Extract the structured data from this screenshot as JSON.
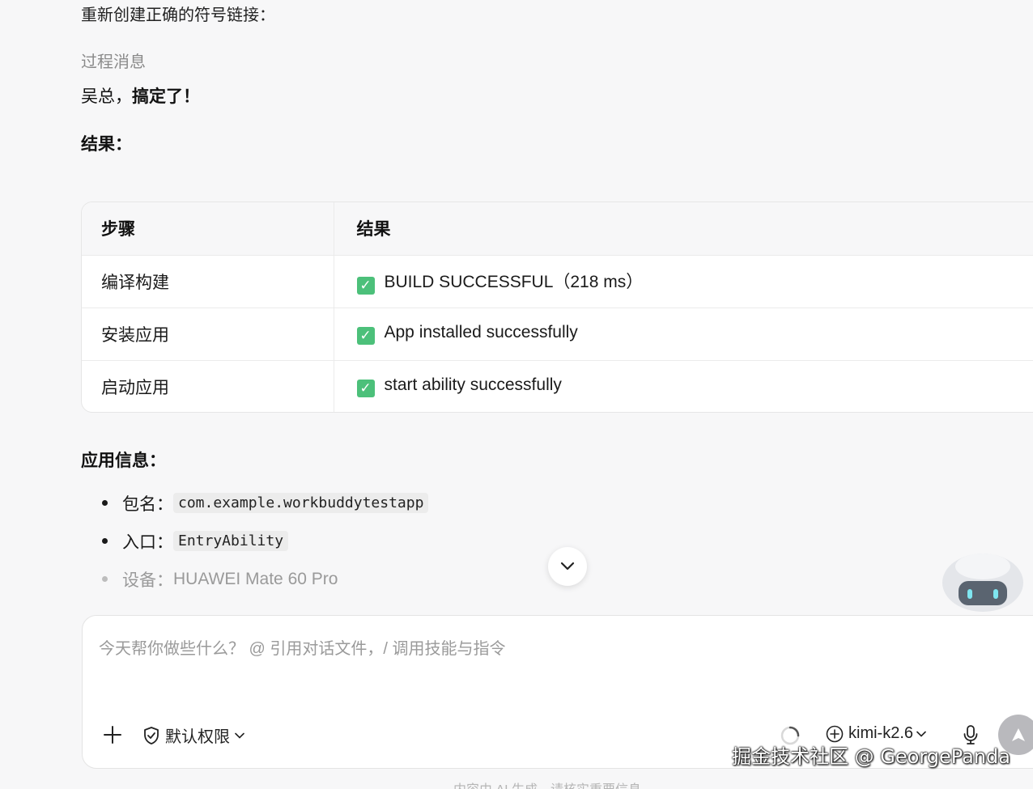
{
  "message": {
    "top_line": "重新创建正确的符号链接：",
    "process_label": "过程消息",
    "greeting_prefix": "吴总，",
    "greeting_bold": "搞定了！",
    "result_title": "结果："
  },
  "result_table": {
    "headers": [
      "步骤",
      "结果"
    ],
    "rows": [
      {
        "step": "编译构建",
        "result": "BUILD SUCCESSFUL（218 ms）"
      },
      {
        "step": "安装应用",
        "result": "App installed successfully"
      },
      {
        "step": "启动应用",
        "result": "start ability successfully"
      }
    ],
    "status_icon": "check-mark-icon",
    "status_color": "#4cc07a"
  },
  "app_info": {
    "title": "应用信息：",
    "items": [
      {
        "label": "包名：",
        "value": "com.example.workbuddytestapp"
      },
      {
        "label": "入口：",
        "value": "EntryAbility"
      },
      {
        "label": "设备：",
        "value": "HUAWEI Mate 60 Pro"
      }
    ]
  },
  "composer": {
    "placeholder": "今天帮你做些什么？ @ 引用对话文件，/ 调用技能与指令",
    "permission_label": "默认权限",
    "model_label": "kimi-k2.6"
  },
  "footer_note": "内容由 AI 生成，请核实重要信息",
  "watermark": "掘金技术社区 @ GeorgePanda"
}
